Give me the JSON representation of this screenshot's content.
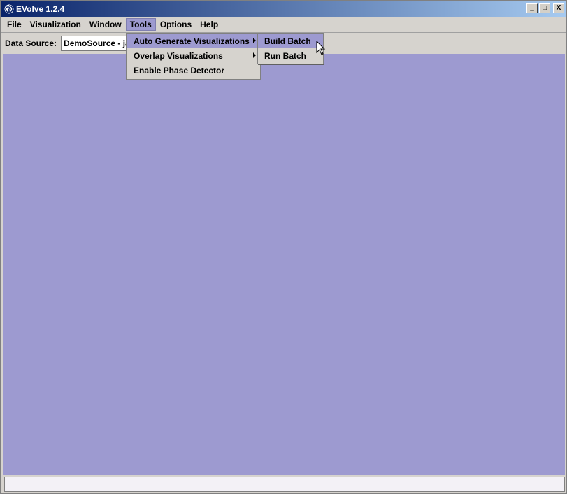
{
  "window": {
    "title": "EVolve 1.2.4"
  },
  "window_controls": {
    "minimize": "_",
    "maximize": "□",
    "close": "X"
  },
  "menubar": [
    {
      "label": "File"
    },
    {
      "label": "Visualization"
    },
    {
      "label": "Window"
    },
    {
      "label": "Tools"
    },
    {
      "label": "Options"
    },
    {
      "label": "Help"
    }
  ],
  "toolbar": {
    "data_source_label": "Data Source:",
    "data_source_value": "DemoSource - ja"
  },
  "tools_menu": [
    {
      "label": "Auto Generate Visualizations",
      "has_submenu": true,
      "highlighted": true
    },
    {
      "label": "Overlap Visualizations",
      "has_submenu": true,
      "highlighted": false
    },
    {
      "label": "Enable Phase Detector",
      "has_submenu": false,
      "highlighted": false
    }
  ],
  "auto_generate_submenu": [
    {
      "label": "Build Batch",
      "highlighted": true
    },
    {
      "label": "Run Batch",
      "highlighted": false
    }
  ],
  "colors": {
    "desktop": "#9d9ad0",
    "highlight": "#9d9ad0",
    "titlebar_start": "#0a246a",
    "titlebar_end": "#a6caf0"
  },
  "status": {
    "text": ""
  }
}
